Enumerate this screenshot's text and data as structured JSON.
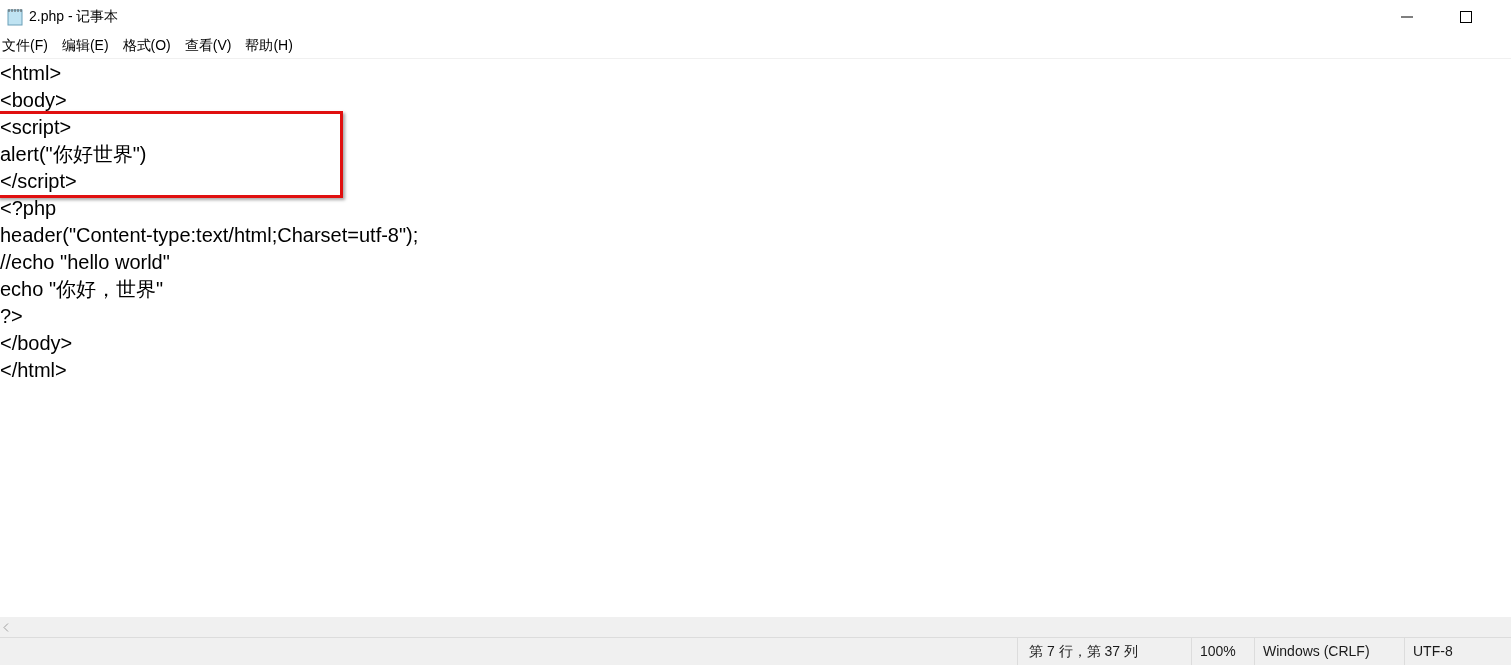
{
  "window": {
    "title": "2.php - 记事本"
  },
  "menu": [
    "文件(F)",
    "编辑(E)",
    "格式(O)",
    "查看(V)",
    "帮助(H)"
  ],
  "editor": {
    "lines": [
      {
        "text": "<html>",
        "highlighted": false
      },
      {
        "text": "<body>",
        "highlighted": false
      },
      {
        "text": "<script>",
        "highlighted": true
      },
      {
        "text": "alert(\"你好世界\")",
        "highlighted": true
      },
      {
        "text": "</script>",
        "highlighted": true
      },
      {
        "text": "<?php",
        "highlighted": false
      },
      {
        "text": "header(\"Content-type:text/html;Charset=utf-8\");",
        "highlighted": false
      },
      {
        "text": "//echo \"hello world\"",
        "highlighted": false
      },
      {
        "text": "echo \"你好，世界\"",
        "highlighted": false
      },
      {
        "text": "?>",
        "highlighted": false
      },
      {
        "text": "</body>",
        "highlighted": false
      },
      {
        "text": "</html>",
        "highlighted": false
      }
    ]
  },
  "status_bar": {
    "position": "第 7 行，第 37 列",
    "zoom": "100%",
    "line_ending": "Windows (CRLF)",
    "encoding": "UTF-8"
  }
}
